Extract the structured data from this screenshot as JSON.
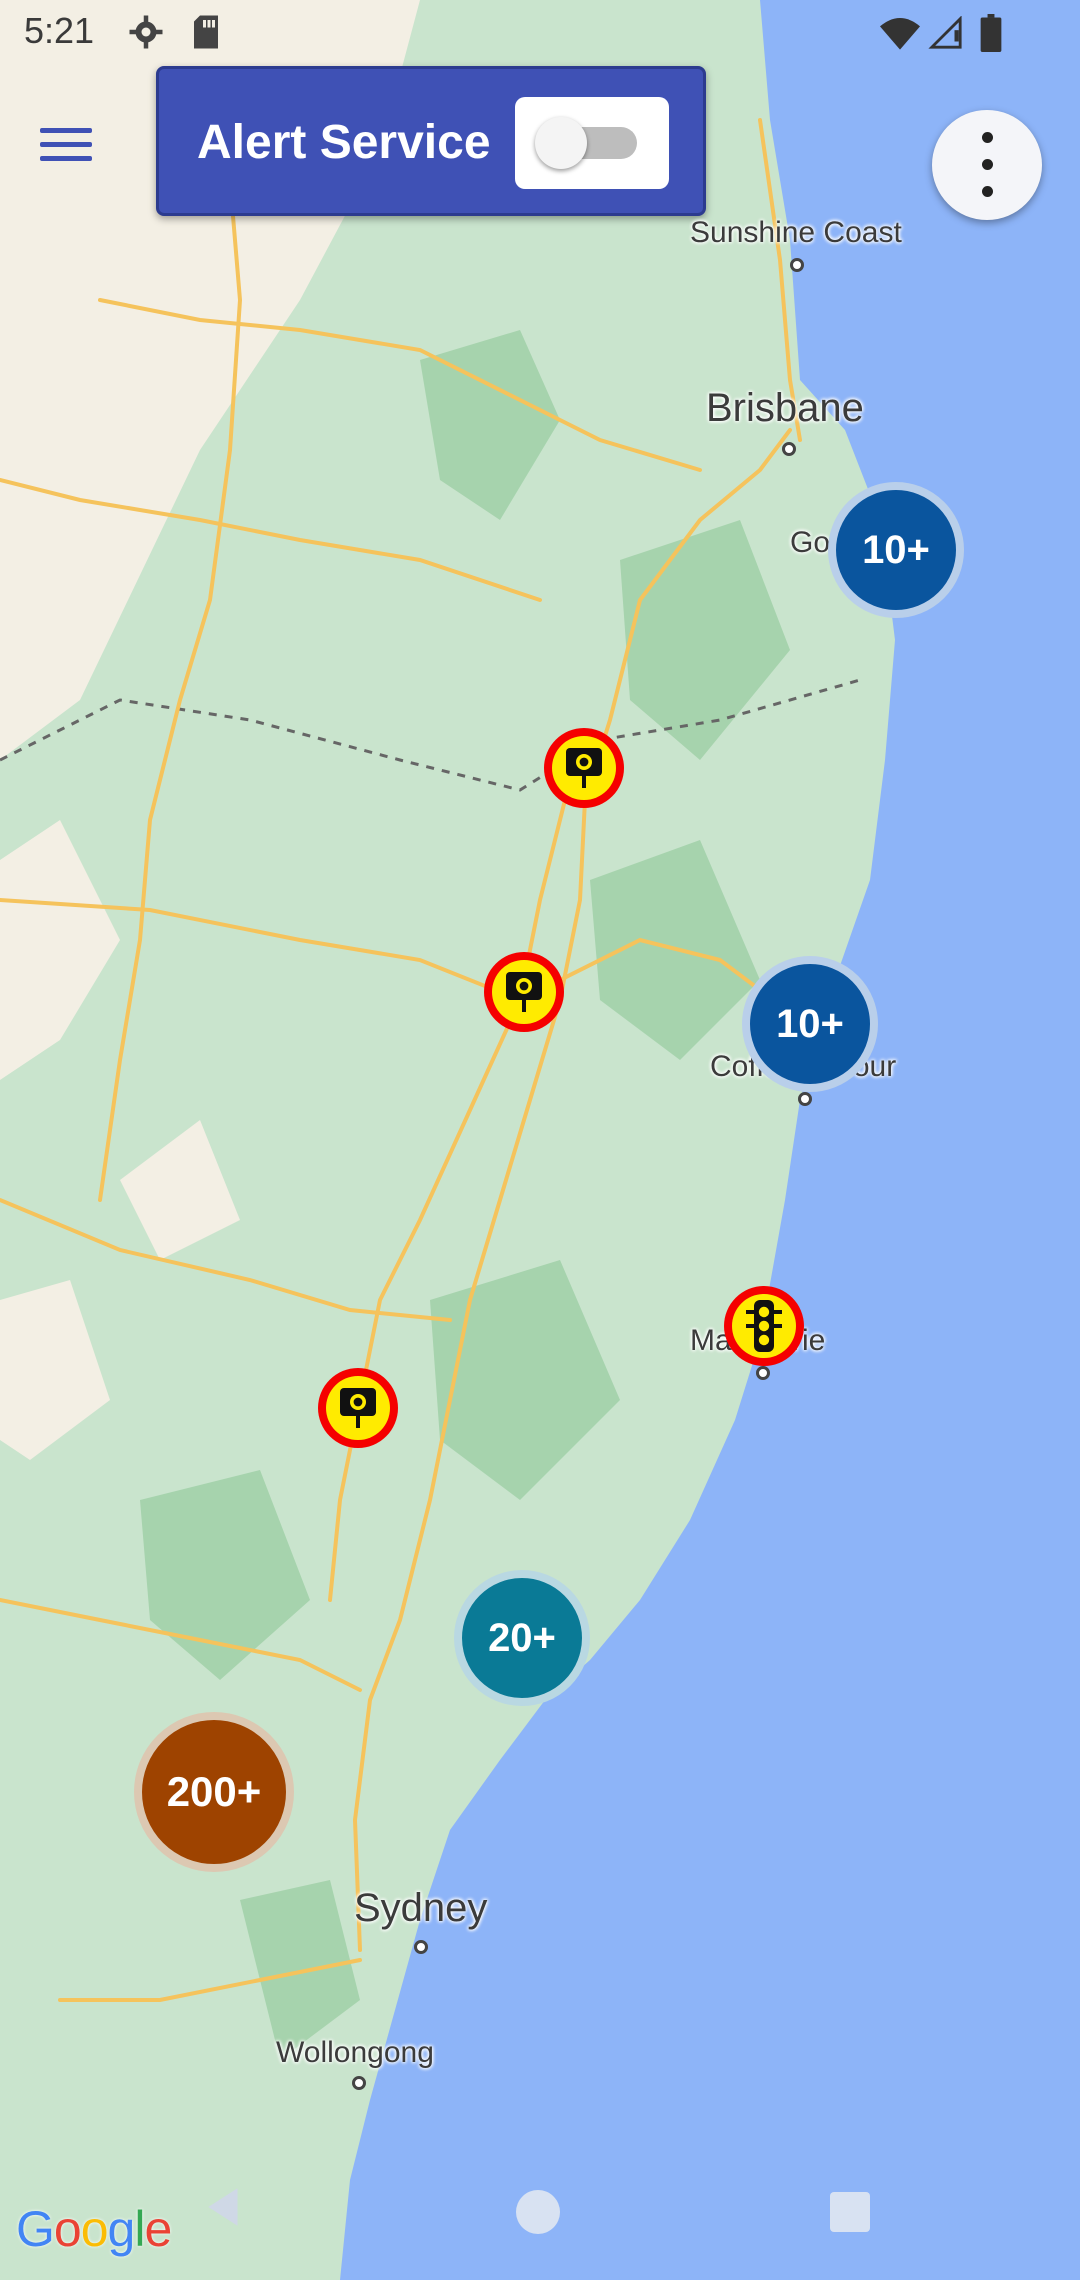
{
  "status_bar": {
    "time": "5:21"
  },
  "header": {
    "alert_label": "Alert Service",
    "alert_enabled": false
  },
  "clusters": [
    {
      "label": "10+",
      "color": "#0a559e"
    },
    {
      "label": "10+",
      "color": "#0a559e"
    },
    {
      "label": "20+",
      "color": "#0a7a96"
    },
    {
      "label": "200+",
      "color": "#9e4300"
    }
  ],
  "markers": [
    {
      "type": "speed-camera"
    },
    {
      "type": "speed-camera"
    },
    {
      "type": "traffic-light-camera"
    },
    {
      "type": "speed-camera"
    }
  ],
  "cities": {
    "sunshine_coast": "Sunshine Coast",
    "brisbane": "Brisbane",
    "gold_coast": "Go",
    "coffs_harbour": "Coffs Harbour",
    "port_macquarie": "Ma",
    "port_macquarie_tail": "rie",
    "sydney": "Sydney",
    "wollongong": "Wollongong"
  },
  "attribution": "Google",
  "colors": {
    "ocean": "#a8c8f8",
    "land": "#cfe8d3",
    "accent": "#3f51b5"
  }
}
